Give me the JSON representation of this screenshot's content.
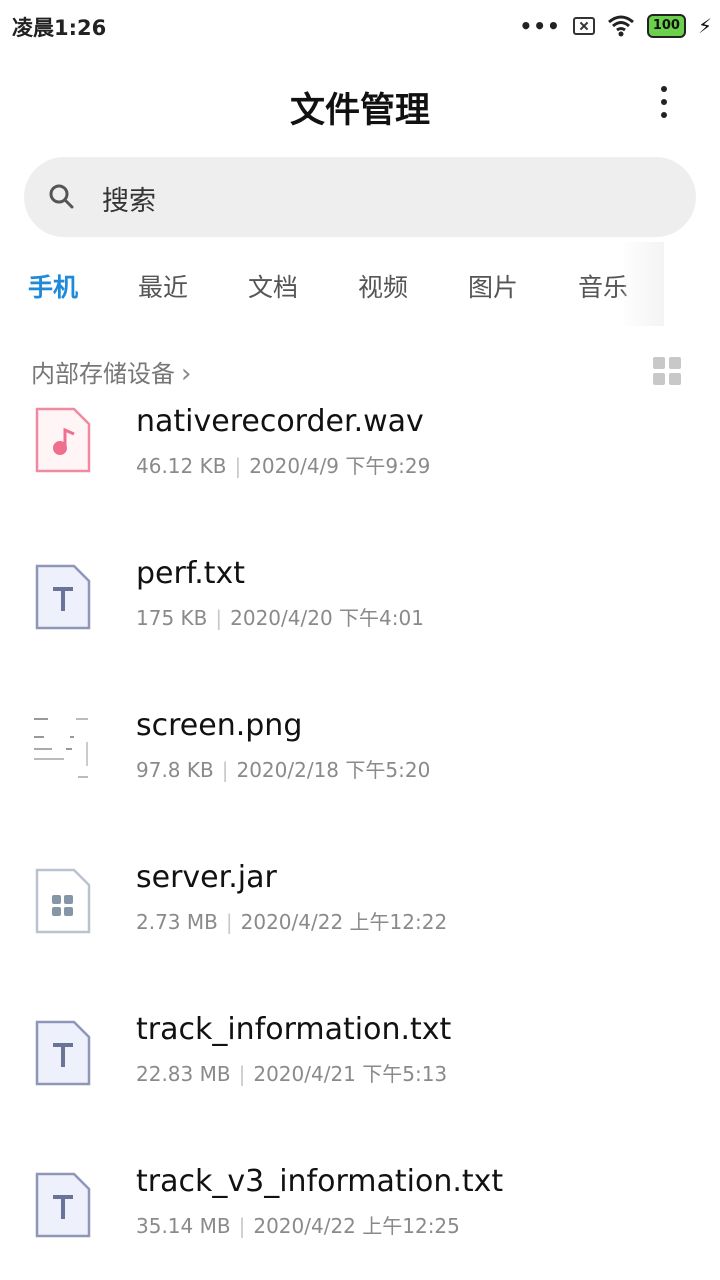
{
  "status_bar": {
    "time": "凌晨1:26",
    "dots": "•••",
    "battery": "100"
  },
  "header": {
    "title": "文件管理"
  },
  "search": {
    "placeholder": "搜索"
  },
  "tabs": [
    {
      "label": "手机",
      "active": true
    },
    {
      "label": "最近"
    },
    {
      "label": "文档"
    },
    {
      "label": "视频"
    },
    {
      "label": "图片"
    },
    {
      "label": "音乐"
    }
  ],
  "path": {
    "label": "内部存储设备"
  },
  "files": [
    {
      "name": "nativerecorder.wav",
      "size": "46.12 KB",
      "date": "2020/4/9 下午9:29",
      "icon": "music-file-icon"
    },
    {
      "name": "perf.txt",
      "size": "175 KB",
      "date": "2020/4/20 下午4:01",
      "icon": "text-file-icon"
    },
    {
      "name": "screen.png",
      "size": "97.8 KB",
      "date": "2020/2/18 下午5:20",
      "icon": "image-thumbnail-icon"
    },
    {
      "name": "server.jar",
      "size": "2.73 MB",
      "date": "2020/4/22 上午12:22",
      "icon": "archive-file-icon"
    },
    {
      "name": "track_information.txt",
      "size": "22.83 MB",
      "date": "2020/4/21 下午5:13",
      "icon": "text-file-icon"
    },
    {
      "name": "track_v3_information.txt",
      "size": "35.14 MB",
      "date": "2020/4/22 上午12:25",
      "icon": "text-file-icon"
    }
  ],
  "colors": {
    "accent": "#1f8ad9",
    "meta_text": "#8a8a8a",
    "search_bg": "#eeeeee"
  }
}
